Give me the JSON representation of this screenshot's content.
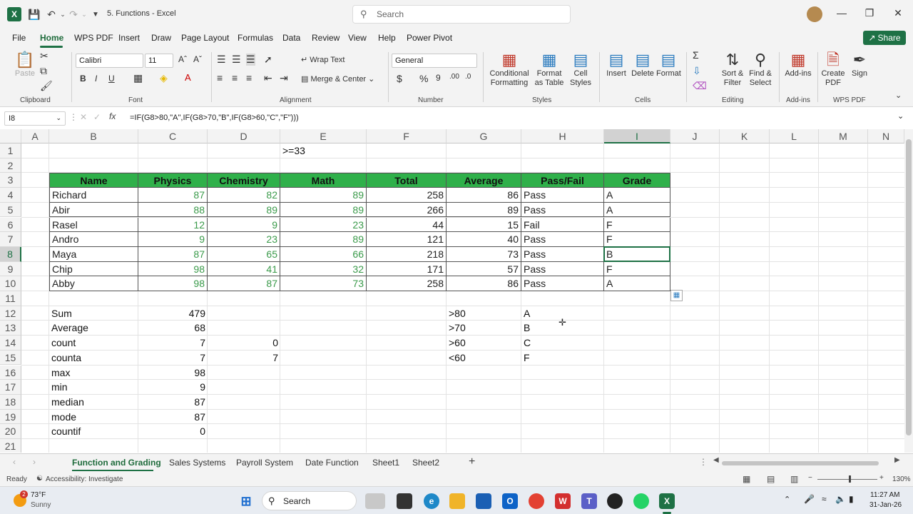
{
  "title": {
    "quick_access": [
      "excel-logo-icon",
      "autosave-icon",
      "undo-icon",
      "redo-icon",
      "customize-icon"
    ],
    "document": "5. Functions  -  Excel",
    "search_placeholder": "Search"
  },
  "menu": [
    "File",
    "Home",
    "WPS PDF",
    "Insert",
    "Draw",
    "Page Layout",
    "Formulas",
    "Data",
    "Review",
    "View",
    "Help",
    "Power Pivot"
  ],
  "share_label": "Share",
  "ribbon": {
    "clipboard": {
      "paste": "Paste",
      "label": "Clipboard"
    },
    "font": {
      "name": "Calibri",
      "size": "11",
      "label": "Font"
    },
    "alignment": {
      "wrap": "Wrap Text",
      "merge": "Merge & Center",
      "label": "Alignment"
    },
    "number": {
      "format": "General",
      "label": "Number"
    },
    "styles": {
      "conditional": "Conditional Formatting",
      "format_table": "Format as Table",
      "cell_styles": "Cell Styles",
      "label": "Styles"
    },
    "cells": {
      "insert": "Insert",
      "delete": "Delete",
      "format": "Format",
      "label": "Cells"
    },
    "editing": {
      "sort": "Sort & Filter",
      "find": "Find & Select",
      "label": "Editing"
    },
    "addins": {
      "addins": "Add-ins",
      "label": "Add-ins"
    },
    "wps": {
      "create": "Create PDF",
      "sign": "Sign",
      "label": "WPS PDF"
    }
  },
  "formula_bar": {
    "name_box": "I8",
    "fx": "fx",
    "formula": "=IF(G8>80,\"A\",IF(G8>70,\"B\",IF(G8>60,\"C\",\"F\")))"
  },
  "columns": [
    "A",
    "B",
    "C",
    "D",
    "E",
    "F",
    "G",
    "H",
    "I",
    "J",
    "K",
    "L",
    "M",
    "N"
  ],
  "rows": [
    "1",
    "2",
    "3",
    "4",
    "5",
    "6",
    "7",
    "8",
    "9",
    "10",
    "11",
    "12",
    "13",
    "14",
    "15",
    "16",
    "17",
    "18",
    "19",
    "20",
    "21"
  ],
  "e1_text": ">=33",
  "table": {
    "headers": [
      "Name",
      "Physics",
      "Chemistry",
      "Math",
      "Total",
      "Average",
      "Pass/Fail",
      "Grade"
    ],
    "rows": [
      [
        "Richard",
        "87",
        "82",
        "89",
        "258",
        "86",
        "Pass",
        "A"
      ],
      [
        "Abir",
        "88",
        "89",
        "89",
        "266",
        "89",
        "Pass",
        "A"
      ],
      [
        "Rasel",
        "12",
        "9",
        "23",
        "44",
        "15",
        "Fail",
        "F"
      ],
      [
        "Andro",
        "9",
        "23",
        "89",
        "121",
        "40",
        "Pass",
        "F"
      ],
      [
        "Maya",
        "87",
        "65",
        "66",
        "218",
        "73",
        "Pass",
        "B"
      ],
      [
        "Chip",
        "98",
        "41",
        "32",
        "171",
        "57",
        "Pass",
        "F"
      ],
      [
        "Abby",
        "98",
        "87",
        "73",
        "258",
        "86",
        "Pass",
        "A"
      ]
    ]
  },
  "stats": [
    {
      "label": "Sum",
      "c": "479",
      "d": ""
    },
    {
      "label": "Average",
      "c": "68",
      "d": ""
    },
    {
      "label": "count",
      "c": "7",
      "d": "0"
    },
    {
      "label": "counta",
      "c": "7",
      "d": "7"
    },
    {
      "label": "max",
      "c": "98",
      "d": ""
    },
    {
      "label": "min",
      "c": "9",
      "d": ""
    },
    {
      "label": "median",
      "c": "87",
      "d": ""
    },
    {
      "label": "mode",
      "c": "87",
      "d": ""
    },
    {
      "label": "countif",
      "c": "0",
      "d": ""
    }
  ],
  "grade_rules": [
    {
      "cond": ">80",
      "grade": "A"
    },
    {
      "cond": ">70",
      "grade": "B"
    },
    {
      "cond": ">60",
      "grade": "C"
    },
    {
      "cond": "<60",
      "grade": "F"
    }
  ],
  "sheet_tabs": [
    "Function and Grading",
    "Sales Systems",
    "Payroll System",
    "Date Function",
    "Sheet1",
    "Sheet2"
  ],
  "status": {
    "ready": "Ready",
    "accessibility": "Accessibility: Investigate",
    "zoom": "130%"
  },
  "taskbar": {
    "temp": "73°F",
    "weather": "Sunny",
    "badge": "2",
    "search": "Search",
    "time": "11:27 AM",
    "date": "31-Jan-26"
  },
  "colors": {
    "excel_green": "#1e7145",
    "header_fill": "#2fb04a",
    "value_green": "#3a9a4a"
  }
}
